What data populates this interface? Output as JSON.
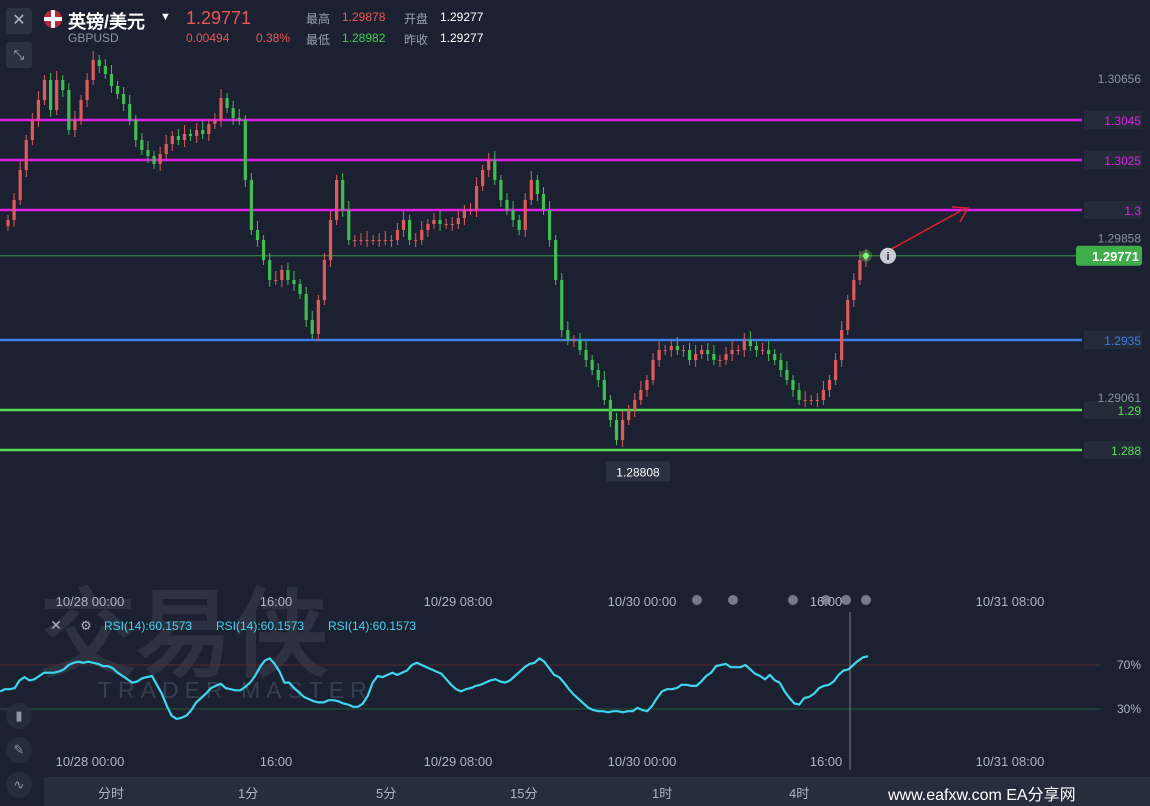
{
  "header": {
    "pair_name": "英镑/美元",
    "pair_code": "GBPUSD",
    "last_price": "1.29771",
    "change": "0.00494",
    "change_pct": "0.38%",
    "high_label": "最高",
    "high_value": "1.29878",
    "low_label": "最低",
    "low_value": "1.28982",
    "open_label": "开盘",
    "open_value": "1.29277",
    "prev_close_label": "昨收",
    "prev_close_value": "1.29277"
  },
  "watermark": {
    "main": "交易侠",
    "sub": "TRADER MASTER"
  },
  "colors": {
    "background": "#1b2130",
    "up": "#e05a5a",
    "down": "#3fbf4f",
    "magenta": "#e020e8",
    "blue": "#3e7fe8",
    "green": "#52e052",
    "rsi": "#3ed7f0",
    "arrow": "#e02030"
  },
  "chart_data": [
    {
      "type": "candlestick",
      "ylim": [
        1.2862,
        1.3083
      ],
      "x_ticks": [
        "10/28 00:00",
        "16:00",
        "10/29 08:00",
        "10/30 00:00",
        "16:00",
        "10/31 08:00"
      ],
      "price_labels": [
        "1.30656",
        "1.29858",
        "1.29061"
      ],
      "low_marker": "1.28808",
      "current_price": "1.29771",
      "levels": [
        {
          "value": 1.3045,
          "label": "1.3045",
          "color": "#e020e8"
        },
        {
          "value": 1.3025,
          "label": "1.3025",
          "color": "#e020e8"
        },
        {
          "value": 1.3,
          "label": "1.3",
          "color": "#e020e8"
        },
        {
          "value": 1.2935,
          "label": "1.2935",
          "color": "#3e7fe8"
        },
        {
          "value": 1.29,
          "label": "1.29",
          "color": "#52e052"
        },
        {
          "value": 1.288,
          "label": "1.288",
          "color": "#52e052"
        }
      ],
      "close": [
        1.2995,
        1.3005,
        1.302,
        1.3035,
        1.3045,
        1.3055,
        1.3065,
        1.305,
        1.3065,
        1.306,
        1.304,
        1.3045,
        1.3055,
        1.3065,
        1.3075,
        1.3072,
        1.3068,
        1.3062,
        1.3058,
        1.3053,
        1.3045,
        1.3035,
        1.303,
        1.3027,
        1.3023,
        1.3028,
        1.3033,
        1.3037,
        1.3035,
        1.3038,
        1.3037,
        1.304,
        1.3038,
        1.3043,
        1.3045,
        1.3056,
        1.3051,
        1.3046,
        1.3045,
        1.3015,
        1.299,
        1.2985,
        1.2975,
        1.2965,
        1.2965,
        1.297,
        1.2965,
        1.2963,
        1.2958,
        1.2945,
        1.2938,
        1.2955,
        1.2975,
        1.2995,
        1.3015,
        1.3,
        1.2985,
        1.2985,
        1.2985,
        1.2985,
        1.2985,
        1.2985,
        1.2985,
        1.2985,
        1.299,
        1.2995,
        1.2985,
        1.2985,
        1.299,
        1.2993,
        1.2995,
        1.2993,
        1.2993,
        1.2993,
        1.2996,
        1.3,
        1.3,
        1.3012,
        1.302,
        1.3025,
        1.3015,
        1.3005,
        1.3,
        1.2995,
        1.299,
        1.3005,
        1.3015,
        1.3008,
        1.3,
        1.2985,
        1.2965,
        1.294,
        1.2935,
        1.2935,
        1.293,
        1.2925,
        1.292,
        1.2915,
        1.2905,
        1.2895,
        1.2885,
        1.2895,
        1.29,
        1.2905,
        1.291,
        1.2915,
        1.2925,
        1.293,
        1.293,
        1.2932,
        1.293,
        1.293,
        1.2925,
        1.2928,
        1.293,
        1.2928,
        1.2925,
        1.2925,
        1.2928,
        1.293,
        1.293,
        1.2935,
        1.2932,
        1.293,
        1.293,
        1.2928,
        1.2925,
        1.292,
        1.2915,
        1.291,
        1.2905,
        1.2905,
        1.2905,
        1.2905,
        1.291,
        1.2915,
        1.2925,
        1.294,
        1.2955,
        1.2965,
        1.2975,
        1.2978
      ],
      "x_labels": [
        "分时",
        "1分",
        "5分",
        "15分",
        "1时",
        "4时"
      ]
    },
    {
      "type": "line",
      "title_labels": [
        "RSI(14):60.1573",
        "RSI(14):60.1573",
        "RSI(14):60.1573"
      ],
      "levels": [
        "70%",
        "30%"
      ],
      "ylim": [
        0,
        100
      ],
      "values": [
        46,
        48,
        48,
        49,
        56,
        59,
        56,
        57,
        60,
        63,
        63,
        63,
        64,
        66,
        70,
        72,
        73,
        72,
        73,
        72,
        71,
        69,
        69,
        67,
        63,
        60,
        57,
        54,
        55,
        58,
        59,
        60,
        52,
        44,
        33,
        24,
        21,
        22,
        24,
        29,
        36,
        40,
        44,
        49,
        51,
        53,
        49,
        48,
        47,
        47,
        50,
        54,
        60,
        68,
        74,
        76,
        71,
        64,
        54,
        54,
        49,
        45,
        41,
        39,
        37,
        36,
        36,
        38,
        38,
        37,
        35,
        34,
        32,
        32,
        35,
        42,
        54,
        60,
        59,
        61,
        63,
        61,
        63,
        65,
        70,
        72,
        70,
        68,
        66,
        64,
        62,
        57,
        52,
        48,
        46,
        48,
        49,
        51,
        52,
        54,
        56,
        57,
        55,
        54,
        56,
        60,
        64,
        68,
        71,
        72,
        76,
        73,
        67,
        61,
        59,
        54,
        48,
        43,
        39,
        35,
        31,
        29,
        28,
        28,
        27,
        28,
        28,
        27,
        28,
        28,
        31,
        29,
        28,
        33,
        40,
        46,
        48,
        48,
        49,
        52,
        52,
        51,
        51,
        55,
        60,
        63,
        69,
        70,
        71,
        68,
        68,
        68,
        70,
        66,
        62,
        60,
        57,
        61,
        56,
        54,
        46,
        40,
        35,
        34,
        40,
        41,
        44,
        49,
        51,
        52,
        55,
        61,
        65,
        66,
        70,
        74,
        77,
        78
      ]
    }
  ],
  "rsi_x_ticks": [
    "10/28 00:00",
    "16:00",
    "10/29 08:00",
    "10/30 00:00",
    "16:00",
    "10/31 08:00"
  ],
  "timeframes": [
    "分时",
    "1分",
    "5分",
    "15分",
    "1时",
    "4时"
  ],
  "site": "www.eafxw.com   EA分享网"
}
